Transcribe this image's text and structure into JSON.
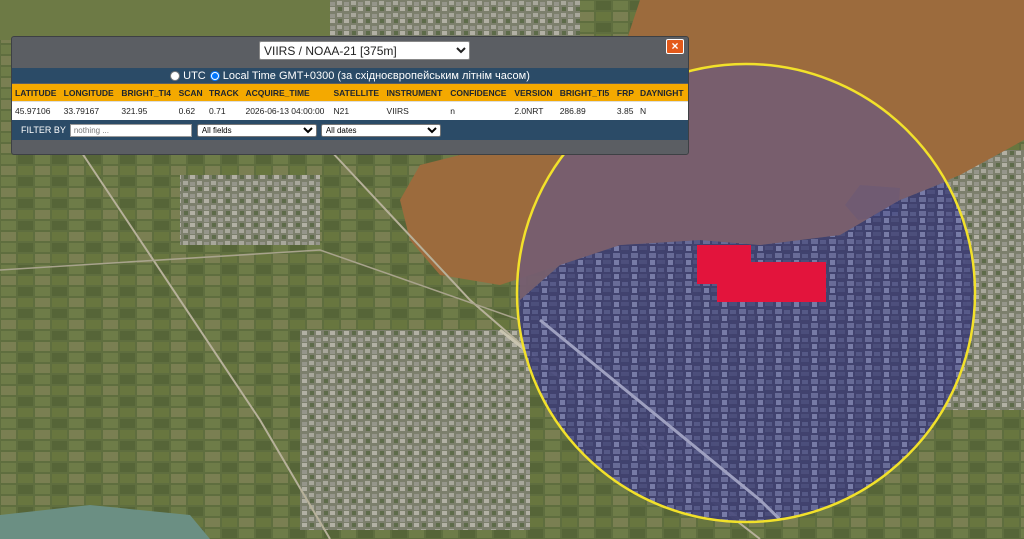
{
  "map": {
    "fire_color": "#e3143c",
    "circle_color": "#f2e12a",
    "water_color": "#9c6b3d"
  },
  "panel": {
    "sensor_options": [
      "VIIRS / NOAA-21 [375m]"
    ],
    "sensor_selected": "VIIRS / NOAA-21 [375m]",
    "close_icon": "×",
    "time": {
      "utc_label": "UTC",
      "local_label": "Local Time GMT+0300 (за східноєвропейським літнім часом)",
      "selected": "local"
    },
    "columns": [
      "LATITUDE",
      "LONGITUDE",
      "BRIGHT_TI4",
      "SCAN",
      "TRACK",
      "ACQUIRE_TIME",
      "SATELLITE",
      "INSTRUMENT",
      "CONFIDENCE",
      "VERSION",
      "BRIGHT_TI5",
      "FRP",
      "DAYNIGHT"
    ],
    "rows": [
      [
        "45.97106",
        "33.79167",
        "321.95",
        "0.62",
        "0.71",
        "2026-06-13 04:00:00",
        "N21",
        "VIIRS",
        "n",
        "2.0NRT",
        "286.89",
        "3.85",
        "N"
      ]
    ],
    "filter": {
      "label": "FILTER BY",
      "placeholder": "nothing ...",
      "fields_selected": "All fields",
      "dates_selected": "All dates"
    }
  }
}
